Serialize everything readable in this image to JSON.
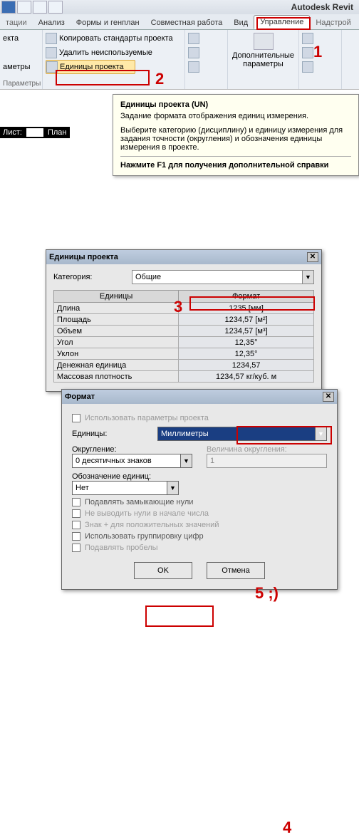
{
  "app_title": "Autodesk Revit",
  "tabs": {
    "t0": "тации",
    "t1": "Анализ",
    "t2": "Формы и генплан",
    "t3": "Совместная работа",
    "t4": "Вид",
    "t5": "Управление",
    "t6": "Надстрой"
  },
  "ribbon": {
    "p1_r1": "екта",
    "p1_r2": "аметры",
    "p1_label": "Параметры",
    "copy_std": "Копировать стандарты проекта",
    "clear_unused": "Удалить неиспользуемые",
    "units_btn": "Единицы проекта",
    "addl_top": "Дополнительные",
    "addl_bot": "параметры"
  },
  "marks": {
    "m1": "1",
    "m2": "2",
    "m3": "3",
    "m4": "4",
    "m5": "5 ;)"
  },
  "tooltip": {
    "title": "Единицы проекта (UN)",
    "l1": "Задание формата отображения единиц измерения.",
    "l2": "Выберите категорию (дисциплину) и единицу измерения для задания точности (округления) и обозначения единицы измерения в проекте.",
    "foot": "Нажмите F1 для получения дополнительной справки"
  },
  "sheet": {
    "label": "Лист:",
    "plan": "План"
  },
  "dlg_units": {
    "title": "Единицы проекта",
    "cat_label": "Категория:",
    "cat_value": "Общие",
    "col1": "Единицы",
    "col2": "Формат",
    "rows": [
      {
        "u": "Длина",
        "f": "1235 [мм]"
      },
      {
        "u": "Площадь",
        "f": "1234,57 [м²]"
      },
      {
        "u": "Объем",
        "f": "1234,57 [м³]"
      },
      {
        "u": "Угол",
        "f": "12,35°"
      },
      {
        "u": "Уклон",
        "f": "12,35°"
      },
      {
        "u": "Денежная единица",
        "f": "1234,57"
      },
      {
        "u": "Массовая плотность",
        "f": "1234,57 кг/куб. м"
      }
    ]
  },
  "dlg_format": {
    "title": "Формат",
    "use_proj": "Использовать параметры проекта",
    "units_lab": "Единицы:",
    "units_val": "Миллиметры",
    "round_lab": "Округление:",
    "round_val": "0 десятичных знаков",
    "roundv_lab": "Величина округления:",
    "roundv_val": "1",
    "sym_lab": "Обозначение единиц:",
    "sym_val": "Нет",
    "chk1": "Подавлять замыкающие нули",
    "chk2": "Не выводить нули в начале числа",
    "chk3": "Знак + для положительных значений",
    "chk4": "Использовать группировку цифр",
    "chk5": "Подавлять пробелы",
    "ok": "OK",
    "cancel": "Отмена"
  }
}
